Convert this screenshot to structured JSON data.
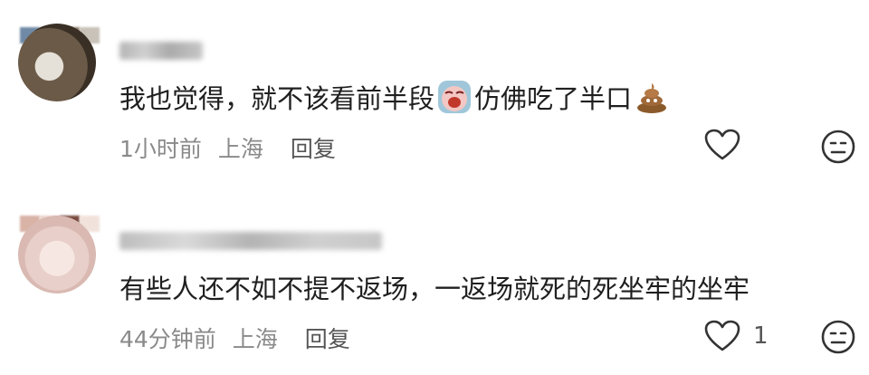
{
  "comments": [
    {
      "text_before_emoji": "我也觉得，就不该看前半段",
      "text_mid": "仿佛吃了半口",
      "emojis": [
        "crying-face-sticker",
        "poop-emoji"
      ],
      "time": "1小时前",
      "location": "上海",
      "reply_label": "回复",
      "like_count": ""
    },
    {
      "text_before_emoji": "有些人还不如不提不返场，一返场就死的死坐牢的坐牢",
      "time": "44分钟前",
      "location": "上海",
      "reply_label": "回复",
      "like_count": "1"
    }
  ]
}
